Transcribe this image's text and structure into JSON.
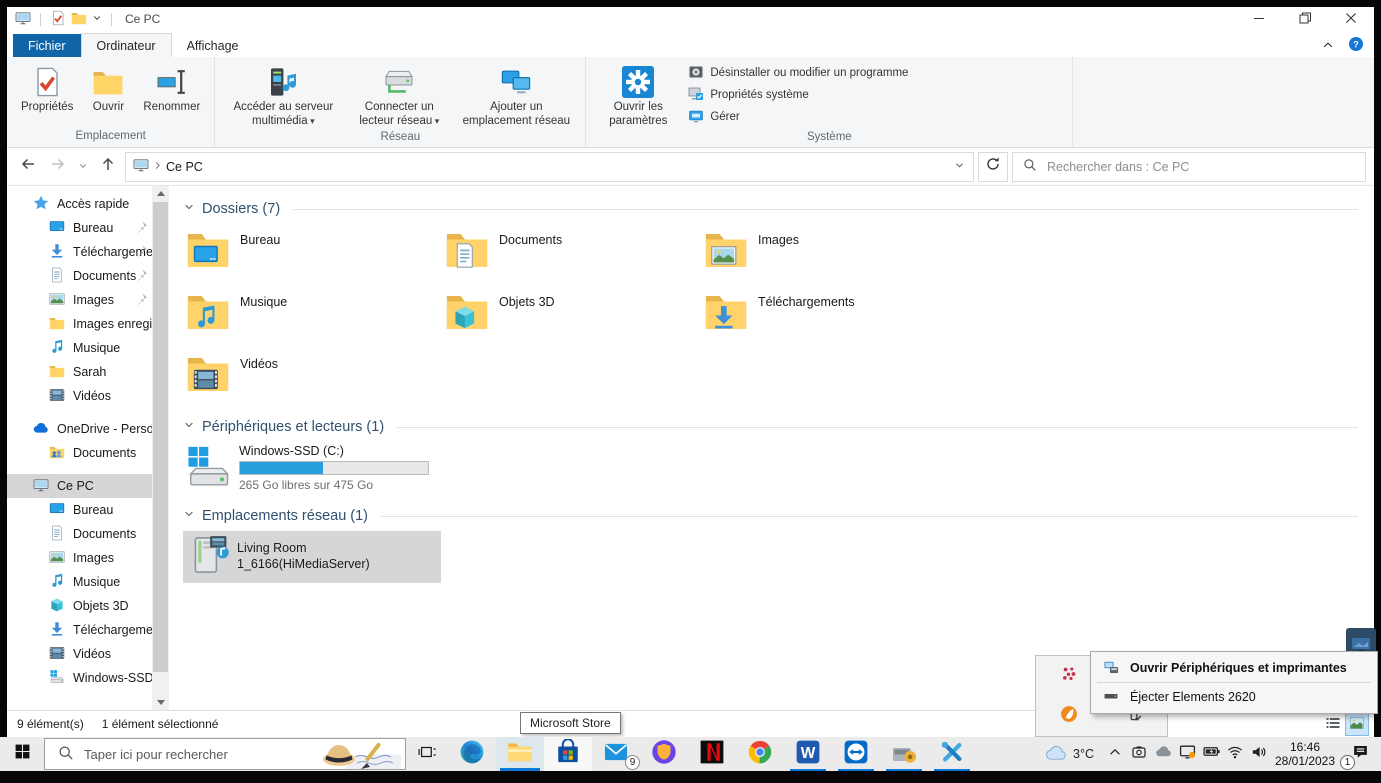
{
  "titlebar": {
    "title": "Ce PC"
  },
  "tabs": {
    "file": "Fichier",
    "computer": "Ordinateur",
    "view": "Affichage"
  },
  "ribbon": {
    "emplacement": {
      "label": "Emplacement",
      "properties": "Propriétés",
      "open": "Ouvrir",
      "rename": "Renommer"
    },
    "reseau": {
      "label": "Réseau",
      "media_server": "Accéder au serveur multimédia",
      "map_drive": "Connecter un lecteur réseau",
      "add_location": "Ajouter un emplacement réseau"
    },
    "systeme": {
      "label": "Système",
      "open_settings": "Ouvrir les paramètres",
      "uninstall": "Désinstaller ou modifier un programme",
      "sys_props": "Propriétés système",
      "manage": "Gérer"
    }
  },
  "navbar": {
    "path": "Ce PC",
    "search_placeholder": "Rechercher dans : Ce PC"
  },
  "sidebar": {
    "items": [
      {
        "label": "Accès rapide",
        "icon": "star",
        "level": 0
      },
      {
        "label": "Bureau",
        "icon": "desktop",
        "level": 1,
        "pinned": true
      },
      {
        "label": "Téléchargements",
        "icon": "download",
        "level": 1,
        "pinned": true
      },
      {
        "label": "Documents",
        "icon": "document",
        "level": 1,
        "pinned": true
      },
      {
        "label": "Images",
        "icon": "picture",
        "level": 1,
        "pinned": true
      },
      {
        "label": "Images enregistrées",
        "icon": "folder",
        "level": 1
      },
      {
        "label": "Musique",
        "icon": "music",
        "level": 1
      },
      {
        "label": "Sarah",
        "icon": "folder",
        "level": 1
      },
      {
        "label": "Vidéos",
        "icon": "video",
        "level": 1
      },
      {
        "label": "OneDrive - Personnel",
        "icon": "cloud",
        "level": 0,
        "gap_before": true
      },
      {
        "label": "Documents",
        "icon": "folder-shared",
        "level": 1
      },
      {
        "label": "Ce PC",
        "icon": "computer",
        "level": 0,
        "selected": true,
        "gap_before": true
      },
      {
        "label": "Bureau",
        "icon": "desktop",
        "level": 1
      },
      {
        "label": "Documents",
        "icon": "document",
        "level": 1
      },
      {
        "label": "Images",
        "icon": "picture",
        "level": 1
      },
      {
        "label": "Musique",
        "icon": "music",
        "level": 1
      },
      {
        "label": "Objets 3D",
        "icon": "cube",
        "level": 1
      },
      {
        "label": "Téléchargements",
        "icon": "download",
        "level": 1
      },
      {
        "label": "Vidéos",
        "icon": "video",
        "level": 1
      },
      {
        "label": "Windows-SSD (C:)",
        "icon": "drive-win",
        "level": 1
      }
    ]
  },
  "content": {
    "folders_header": "Dossiers (7)",
    "folders": [
      {
        "label": "Bureau",
        "overlay": "desktop"
      },
      {
        "label": "Documents",
        "overlay": "document"
      },
      {
        "label": "Images",
        "overlay": "picture"
      },
      {
        "label": "Musique",
        "overlay": "music"
      },
      {
        "label": "Objets 3D",
        "overlay": "cube"
      },
      {
        "label": "Téléchargements",
        "overlay": "download"
      },
      {
        "label": "Vidéos",
        "overlay": "video"
      }
    ],
    "drives_header": "Périphériques et lecteurs (1)",
    "drive": {
      "name": "Windows-SSD (C:)",
      "free": "265 Go libres sur 475 Go",
      "used_percent": 44
    },
    "network_header": "Emplacements réseau (1)",
    "network": {
      "name_line1": "Living Room",
      "name_line2": "1_6166(HiMediaServer)"
    }
  },
  "statusbar": {
    "items_count": "9 élément(s)",
    "selection": "1 élément sélectionné"
  },
  "tooltip": {
    "text": "Microsoft Store"
  },
  "context_menu": {
    "items": [
      {
        "label": "Ouvrir Périphériques et imprimantes",
        "icon": "devices-printers",
        "bold": true
      },
      {
        "label": "Éjecter Elements 2620",
        "icon": "eject-drive",
        "bold": false
      }
    ]
  },
  "tray_flyout": {
    "icons": [
      {
        "name": "app-red-dots"
      },
      {
        "name": "bluetooth"
      },
      {
        "name": "avast"
      },
      {
        "name": "usb-eject"
      }
    ]
  },
  "taskbar": {
    "search_placeholder": "Taper ici pour rechercher",
    "apps": [
      {
        "name": "edge",
        "icon": "edge"
      },
      {
        "name": "file-explorer",
        "icon": "explorer",
        "state": "active"
      },
      {
        "name": "microsoft-store",
        "icon": "store",
        "state": "hover"
      },
      {
        "name": "mail",
        "icon": "mail",
        "badge": "9"
      },
      {
        "name": "security-shield-app",
        "icon": "shield"
      },
      {
        "name": "netflix",
        "icon": "netflix"
      },
      {
        "name": "chrome",
        "icon": "chrome"
      },
      {
        "name": "word",
        "icon": "word",
        "running": true
      },
      {
        "name": "teamviewer",
        "icon": "teamviewer",
        "running": true
      },
      {
        "name": "disk-utility",
        "icon": "disk-tool",
        "running": true
      },
      {
        "name": "tools-app",
        "icon": "tools",
        "running": true
      }
    ],
    "tray": {
      "temperature": "3°C",
      "time": "16:46",
      "date": "28/01/2023",
      "notification_count": "1"
    }
  },
  "colors": {
    "accent": "#1065a9",
    "selection": "#d6d6d6",
    "progress_fill": "#26a0da",
    "taskbar_indicator": "#0c79d8"
  }
}
